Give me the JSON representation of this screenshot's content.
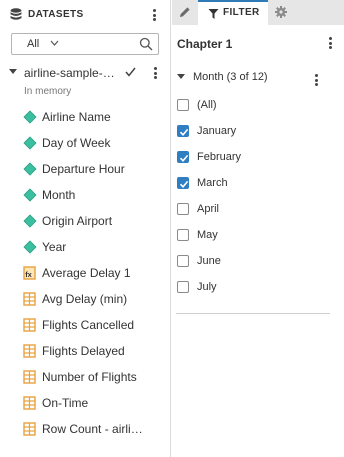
{
  "datasets": {
    "title": "DATASETS",
    "search": {
      "selected": "All"
    },
    "source": {
      "name": "airline-sample-…",
      "status": "In memory"
    },
    "fields": [
      {
        "label": "Airline Name",
        "icon": "dimension-icon"
      },
      {
        "label": "Day of Week",
        "icon": "dimension-icon"
      },
      {
        "label": "Departure Hour",
        "icon": "dimension-icon"
      },
      {
        "label": "Month",
        "icon": "dimension-icon"
      },
      {
        "label": "Origin Airport",
        "icon": "dimension-icon"
      },
      {
        "label": "Year",
        "icon": "dimension-icon"
      },
      {
        "label": "Average Delay 1",
        "icon": "calculated-measure-icon"
      },
      {
        "label": "Avg Delay (min)",
        "icon": "measure-icon"
      },
      {
        "label": "Flights Cancelled",
        "icon": "measure-icon"
      },
      {
        "label": "Flights Delayed",
        "icon": "measure-icon"
      },
      {
        "label": "Number of Flights",
        "icon": "measure-icon"
      },
      {
        "label": "On-Time",
        "icon": "measure-icon"
      },
      {
        "label": "Row Count - airli…",
        "icon": "measure-icon"
      }
    ]
  },
  "tabs": {
    "pencil_icon": "pencil-icon",
    "filter_label": "FILTER",
    "gear_icon": "gear-icon"
  },
  "filter": {
    "chapter": "Chapter 1",
    "month_label": "Month (3 of 12)",
    "options": [
      {
        "label": "(All)",
        "checked": false
      },
      {
        "label": "January",
        "checked": true
      },
      {
        "label": "February",
        "checked": true
      },
      {
        "label": "March",
        "checked": true
      },
      {
        "label": "April",
        "checked": false
      },
      {
        "label": "May",
        "checked": false
      },
      {
        "label": "June",
        "checked": false
      },
      {
        "label": "July",
        "checked": false
      }
    ]
  },
  "colors": {
    "dimension": "#3cbfa0",
    "measure": "#e8a13d",
    "checkbox_on": "#2f7ec1",
    "tab_accent": "#2e7bb8"
  }
}
